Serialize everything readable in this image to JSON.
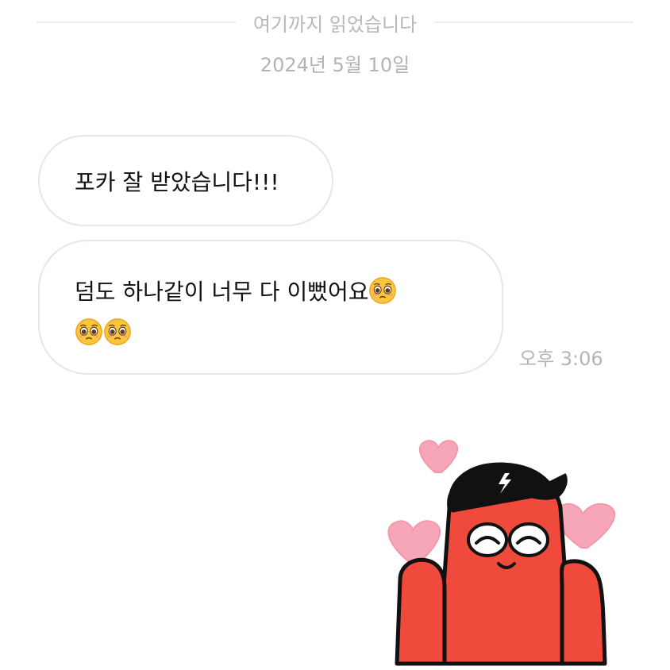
{
  "chat": {
    "read_divider": "여기까지 읽었습니다",
    "date": "2024년 5월 10일",
    "messages": [
      {
        "text": "포카 잘 받았습니다!!!"
      },
      {
        "line1": "덤도 하나같이 너무 다 이뻤어요",
        "emoji": "pleading-face"
      }
    ],
    "timestamp": "오후 3:06",
    "sticker": "red-character-with-cap-and-hearts"
  },
  "colors": {
    "bubble_border": "#e6e6e6",
    "meta_text": "#b5b5b5",
    "sticker_red": "#f04a3c",
    "heart_pink": "#f7a6b7"
  }
}
